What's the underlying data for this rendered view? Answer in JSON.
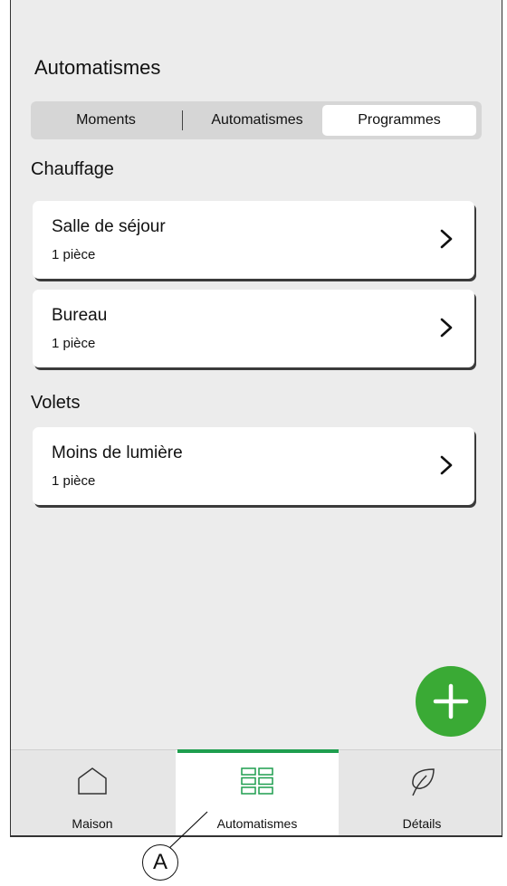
{
  "header": {
    "title": "Automatismes"
  },
  "tabs": [
    {
      "label": "Moments",
      "selected": false
    },
    {
      "label": "Automatismes",
      "selected": false
    },
    {
      "label": "Programmes",
      "selected": true
    }
  ],
  "sections": [
    {
      "title": "Chauffage",
      "items": [
        {
          "title": "Salle de séjour",
          "subtitle": "1 pièce"
        },
        {
          "title": "Bureau",
          "subtitle": "1 pièce"
        }
      ]
    },
    {
      "title": "Volets",
      "items": [
        {
          "title": "Moins de lumière",
          "subtitle": "1 pièce"
        }
      ]
    }
  ],
  "fab": {
    "icon": "plus-icon"
  },
  "nav": [
    {
      "label": "Maison",
      "icon": "house-icon",
      "active": false
    },
    {
      "label": "Automatismes",
      "icon": "grid-icon",
      "active": true
    },
    {
      "label": "Détails",
      "icon": "leaf-icon",
      "active": false
    }
  ],
  "callout": {
    "label": "A"
  },
  "colors": {
    "accent": "#3aaa35",
    "nav_indicator": "#1f9e4f",
    "background": "#ececec"
  }
}
